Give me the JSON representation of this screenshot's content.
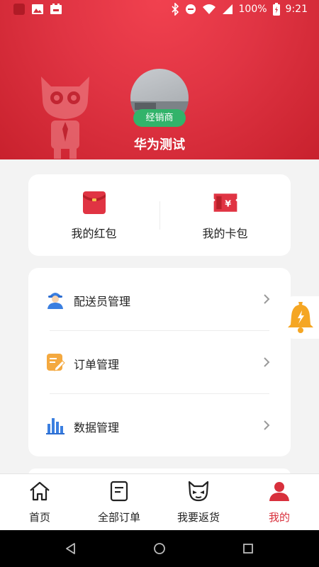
{
  "status_bar": {
    "battery": "100%",
    "time": "9:21"
  },
  "profile": {
    "role_badge": "经销商",
    "name": "华为测试"
  },
  "wallet": {
    "items": [
      {
        "label": "我的红包",
        "icon": "red-envelope-icon"
      },
      {
        "label": "我的卡包",
        "icon": "card-wallet-icon"
      }
    ]
  },
  "menu": {
    "items": [
      {
        "label": "配送员管理",
        "icon": "courier-icon"
      },
      {
        "label": "订单管理",
        "icon": "order-edit-icon"
      },
      {
        "label": "数据管理",
        "icon": "bar-chart-icon"
      }
    ]
  },
  "bottom_nav": {
    "items": [
      {
        "label": "首页",
        "icon": "home-icon"
      },
      {
        "label": "全部订单",
        "icon": "order-list-icon"
      },
      {
        "label": "我要返货",
        "icon": "mascot-face-icon"
      },
      {
        "label": "我的",
        "icon": "person-icon",
        "active": true
      }
    ]
  },
  "colors": {
    "header_red": "#e03443",
    "badge_green": "#32b36a",
    "active_red": "#d8303c"
  }
}
